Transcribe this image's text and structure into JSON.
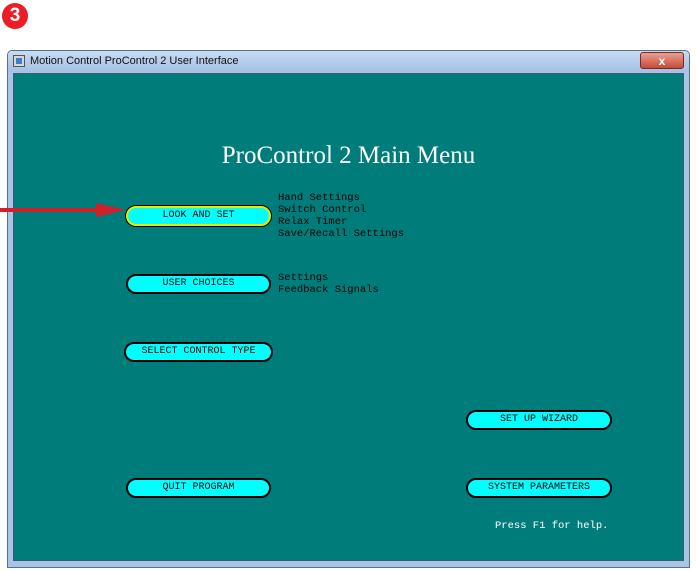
{
  "step_badge": "3",
  "window": {
    "title": "Motion Control ProControl 2 User Interface",
    "close_symbol": "x"
  },
  "main_menu": {
    "title": "ProControl 2 Main Menu",
    "buttons": {
      "look_and_set": "LOOK AND SET",
      "user_choices": "USER CHOICES",
      "select_control_type": "SELECT CONTROL TYPE",
      "set_up_wizard": "SET UP WIZARD",
      "quit_program": "QUIT PROGRAM",
      "system_parameters": "SYSTEM PARAMETERS"
    },
    "look_and_set_items": [
      "Hand Settings",
      "Switch Control",
      "Relax Timer",
      "Save/Recall Settings"
    ],
    "user_choices_items": [
      "Settings",
      "Feedback Signals"
    ],
    "help_text": "Press F1 for help."
  },
  "colors": {
    "background": "#007d7a",
    "button_fill": "#00ffff",
    "highlight_border": "#e8e800",
    "arrow": "#d0202a"
  },
  "icons": [
    "step-3-badge",
    "app-icon",
    "close-icon",
    "red-pointer-arrow"
  ]
}
